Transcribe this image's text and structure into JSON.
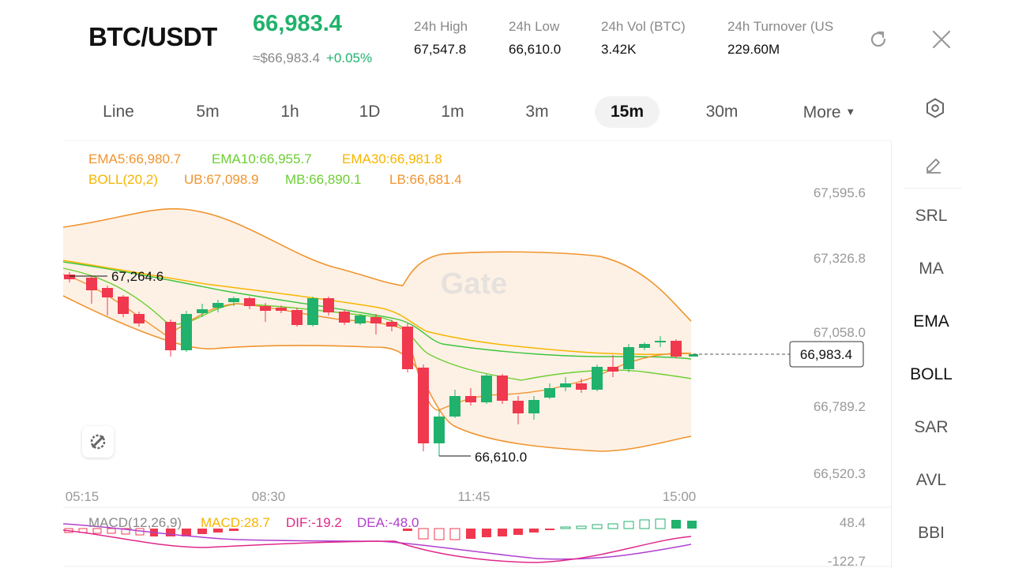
{
  "header": {
    "pair": "BTC/USDT",
    "price": "66,983.4",
    "approx_price": "≈$66,983.4",
    "change": "+0.05%",
    "stats": [
      {
        "label": "24h   High",
        "value": "67,547.8"
      },
      {
        "label": "24h   Low",
        "value": "66,610.0"
      },
      {
        "label": "24h   Vol (BTC)",
        "value": "3.42K"
      },
      {
        "label": "24h   Turnover (US",
        "value": "229.60M"
      }
    ]
  },
  "tabs": [
    "Line",
    "5m",
    "1h",
    "1D",
    "1m",
    "3m",
    "15m",
    "30m",
    "More"
  ],
  "active_tab": "15m",
  "indicators": {
    "ema5": "EMA5:66,980.7",
    "ema10": "EMA10:66,955.7",
    "ema30": "EMA30:66,981.8",
    "boll": "BOLL(20,2)",
    "ub": "UB:67,098.9",
    "mb": "MB:66,890.1",
    "lb": "LB:66,681.4"
  },
  "price_axis": [
    "67,595.6",
    "67,326.8",
    "67,058.0",
    "66,789.2",
    "66,520.3"
  ],
  "time_axis": [
    "05:15",
    "08:30",
    "11:45",
    "15:00"
  ],
  "current_price_tag": "66,983.4",
  "high_marker": "67,264.6",
  "low_marker": "66,610.0",
  "watermark": "Gate",
  "macd": {
    "label": "MACD(12,26,9)",
    "macd": "MACD:28.7",
    "dif": "DIF:-19.2",
    "dea": "DEA:-48.0",
    "axis_top": "48.4",
    "axis_bottom": "-122.7"
  },
  "side_tools": [
    "SRL",
    "MA",
    "EMA",
    "BOLL",
    "SAR",
    "AVL",
    "BBI"
  ],
  "colors": {
    "up": "#20b26c",
    "down": "#f0384e",
    "accent": "#20b26c"
  }
}
